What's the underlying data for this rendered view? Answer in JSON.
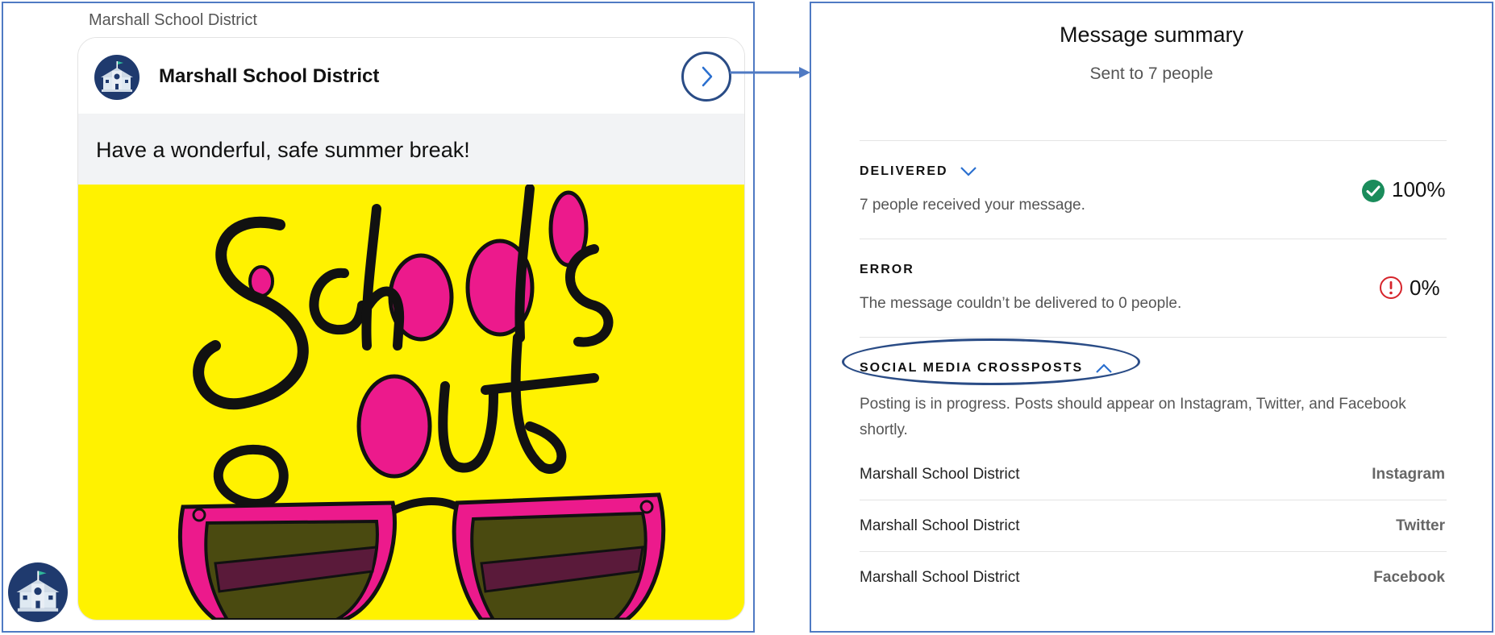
{
  "feed": {
    "label": "Marshall School District",
    "card": {
      "sender": "Marshall School District",
      "message": "Have a wonderful, safe summer break!",
      "image_alt": "School's out"
    }
  },
  "summary": {
    "title": "Message summary",
    "subtitle": "Sent to 7 people",
    "delivered": {
      "label": "DELIVERED",
      "description": "7 people received your message.",
      "percent": "100%",
      "color": "#1a8c5b"
    },
    "error": {
      "label": "ERROR",
      "description": "The message couldn’t be delivered to 0 people.",
      "percent": "0%",
      "color": "#d6242b"
    },
    "crossposts": {
      "label": "SOCIAL MEDIA CROSSPOSTS",
      "description_line1": "Posting is in progress. Posts should appear on Instagram, Twitter, and Facebook",
      "description_line2": "shortly.",
      "rows": [
        {
          "name": "Marshall School District",
          "platform": "Instagram"
        },
        {
          "name": "Marshall School District",
          "platform": "Twitter"
        },
        {
          "name": "Marshall School District",
          "platform": "Facebook"
        }
      ]
    }
  },
  "colors": {
    "accent": "#2a6fcf",
    "annotation": "#2a4c86",
    "poster_bg": "#fff200",
    "poster_pink": "#ec1a8c"
  }
}
